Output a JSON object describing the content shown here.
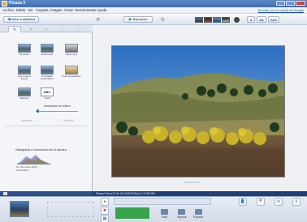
{
  "window": {
    "title": "Picasa 3"
  },
  "menu": {
    "items": [
      "Archivo",
      "Editar",
      "Ver",
      "Carpeta",
      "Imagen",
      "Crear",
      "Herramientas",
      "Ayuda"
    ],
    "signin": "Acceder con tu cuenta de Google"
  },
  "toolbar": {
    "back_label": "Volver a biblioteca",
    "play_label": "Reproducir"
  },
  "left_panel": {
    "tools": [
      {
        "label": "Recortar"
      },
      {
        "label": "Enderezar"
      },
      {
        "label": "Ojos rojos"
      },
      {
        "label": "Voy a tener suerte"
      },
      {
        "label": "Contraste automático"
      },
      {
        "label": "Color automático"
      },
      {
        "label": "Retocar"
      },
      {
        "label": "Texto"
      }
    ],
    "fill_light_label": "Iluminación de relleno",
    "undo_label": "Deshacer",
    "redo_label": "Rehacer",
    "histogram_title": "Histograma e información de la cámara",
    "histogram_note": "No hay datos EXIF disponibles"
  },
  "stage": {
    "caption": "Añadir un título"
  },
  "info": {
    "text": "Picasa Fotos (10 de 15)   4048×3036 px   1,9 MB   28%"
  },
  "bottom": {
    "actions": [
      {
        "label": "Subir"
      },
      {
        "label": "Imprimir"
      },
      {
        "label": "Exportar"
      }
    ]
  },
  "colors": {
    "accent": "#3b6fc4",
    "green_button": "#37a34a",
    "info_strip": "#1f3f78"
  }
}
